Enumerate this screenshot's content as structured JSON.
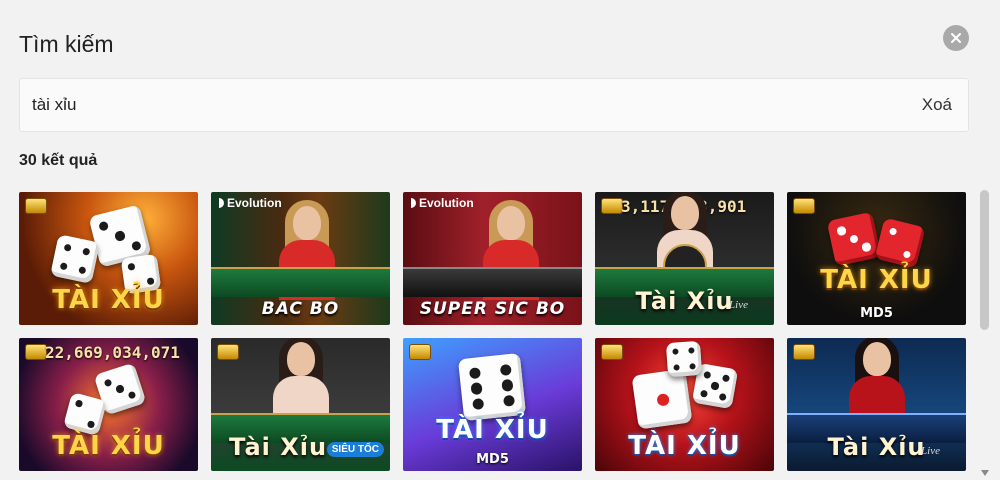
{
  "header": {
    "title": "Tìm kiếm",
    "close_icon": "close-icon"
  },
  "search": {
    "value": "tài xỉu",
    "placeholder": "",
    "clear_label": "Xoá"
  },
  "results": {
    "count_label": "30 kết quả",
    "tiles": [
      {
        "label": "TÀI XỈU",
        "provider": "",
        "jackpot": "",
        "extra": ""
      },
      {
        "label": "BAC BO",
        "provider": "Evolution",
        "jackpot": "",
        "extra": ""
      },
      {
        "label": "SUPER SIC BO",
        "provider": "Evolution",
        "jackpot": "",
        "extra": ""
      },
      {
        "label": "Tài Xỉu",
        "provider": "",
        "jackpot": "3,117,903,901",
        "extra": "Live"
      },
      {
        "label": "TÀI XỈU",
        "provider": "",
        "jackpot": "",
        "extra": "MD5"
      },
      {
        "label": "TÀI XỈU",
        "provider": "",
        "jackpot": "22,669,034,071",
        "extra": ""
      },
      {
        "label": "Tài Xỉu",
        "provider": "",
        "jackpot": "",
        "extra": "SIÊU TỐC"
      },
      {
        "label": "TÀI XỈU",
        "provider": "",
        "jackpot": "",
        "extra": "MD5"
      },
      {
        "label": "TÀI XỈU",
        "provider": "",
        "jackpot": "",
        "extra": ""
      },
      {
        "label": "Tài Xỉu",
        "provider": "",
        "jackpot": "",
        "extra": "Live"
      }
    ]
  },
  "colors": {
    "background": "#f2f2f2",
    "close_button": "#a9a9a9",
    "accent_gold": "#ffd54a"
  }
}
